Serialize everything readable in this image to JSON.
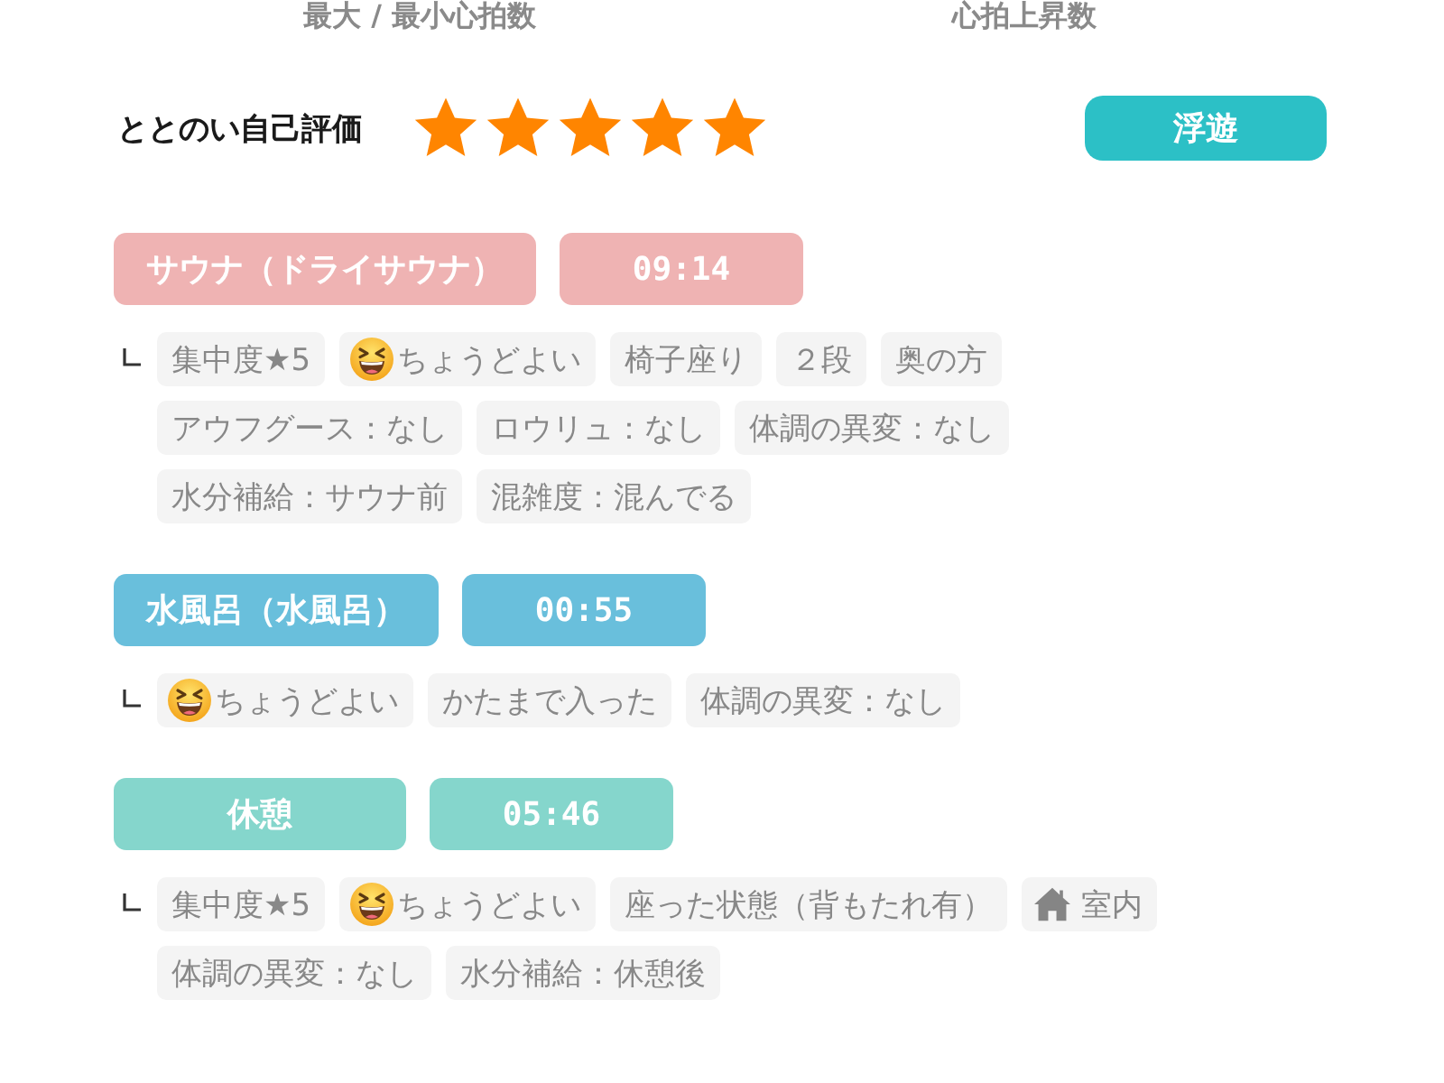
{
  "header_labels": [
    "最大 / 最小心拍数",
    "心拍上昇数"
  ],
  "self_rating": {
    "label": "ととのい自己評価",
    "stars": 5,
    "mood": "浮遊"
  },
  "sessions": [
    {
      "name": "サウナ（ドライサウナ）",
      "time": "09:14",
      "color": "#efb3b3",
      "details": [
        {
          "kind": "plain",
          "text": "集中度★5"
        },
        {
          "kind": "feeling",
          "text": "ちょうどよい"
        },
        {
          "kind": "plain",
          "text": "椅子座り"
        },
        {
          "kind": "plain",
          "text": "２段"
        },
        {
          "kind": "plain",
          "text": "奥の方"
        },
        {
          "kind": "plain",
          "text": "アウフグース：なし"
        },
        {
          "kind": "plain",
          "text": "ロウリュ：なし"
        },
        {
          "kind": "plain",
          "text": "体調の異変：なし"
        },
        {
          "kind": "plain",
          "text": "水分補給：サウナ前"
        },
        {
          "kind": "plain",
          "text": "混雑度：混んでる"
        }
      ]
    },
    {
      "name": "水風呂（水風呂）",
      "time": "00:55",
      "color": "#69bfdc",
      "details": [
        {
          "kind": "feeling",
          "text": "ちょうどよい"
        },
        {
          "kind": "plain",
          "text": "かたまで入った"
        },
        {
          "kind": "plain",
          "text": "体調の異変：なし"
        }
      ]
    },
    {
      "name": "休憩",
      "time": "05:46",
      "color": "#85d6cc",
      "details": [
        {
          "kind": "plain",
          "text": "集中度★5"
        },
        {
          "kind": "feeling",
          "text": "ちょうどよい"
        },
        {
          "kind": "plain",
          "text": "座った状態（背もたれ有）"
        },
        {
          "kind": "place",
          "text": "室内"
        },
        {
          "kind": "plain",
          "text": "体調の異変：なし"
        },
        {
          "kind": "plain",
          "text": "水分補給：休憩後"
        }
      ]
    }
  ]
}
